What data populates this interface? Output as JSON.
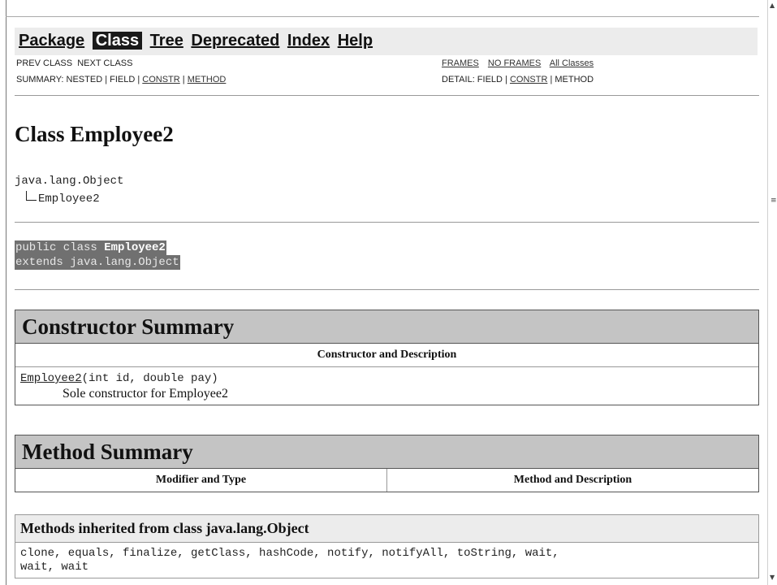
{
  "nav": {
    "items": [
      {
        "label": "Package",
        "current": false
      },
      {
        "label": "Class",
        "current": true
      },
      {
        "label": "Tree",
        "current": false
      },
      {
        "label": "Deprecated",
        "current": false
      },
      {
        "label": "Index",
        "current": false
      },
      {
        "label": "Help",
        "current": false
      }
    ],
    "prev_class": "PREV CLASS",
    "next_class": "NEXT CLASS",
    "summary_prefix": "SUMMARY: NESTED | FIELD | ",
    "summary_constr": "CONSTR",
    "summary_sep": " | ",
    "summary_method": "METHOD",
    "frames": "FRAMES",
    "no_frames": "NO FRAMES",
    "all_classes": "All Classes",
    "detail_prefix": "DETAIL: FIELD | ",
    "detail_constr": "CONSTR",
    "detail_suffix": " | METHOD"
  },
  "class_title": "Class Employee2",
  "inheritance": {
    "parent": "java.lang.Object",
    "child": "Employee2"
  },
  "declaration": {
    "line1_prefix": "public class ",
    "line1_name": "Employee2",
    "line2": "extends java.lang.Object"
  },
  "constructor_summary": {
    "title": "Constructor Summary",
    "column": "Constructor and Description",
    "constructors": [
      {
        "name": "Employee2",
        "params": "(int id, double pay)",
        "description": "Sole constructor for Employee2"
      }
    ]
  },
  "method_summary": {
    "title": "Method Summary",
    "col_modifier": "Modifier and Type",
    "col_method": "Method and Description"
  },
  "inherited": {
    "title": "Methods inherited from class java.lang.Object",
    "line1": "clone, equals, finalize, getClass, hashCode, notify, notifyAll, toString, wait,",
    "line2": "wait, wait"
  },
  "icons": {
    "scroll_up": "scroll-up-arrow-icon",
    "scroll_grip": "scroll-grip-icon",
    "scroll_down": "scroll-down-arrow-icon"
  }
}
